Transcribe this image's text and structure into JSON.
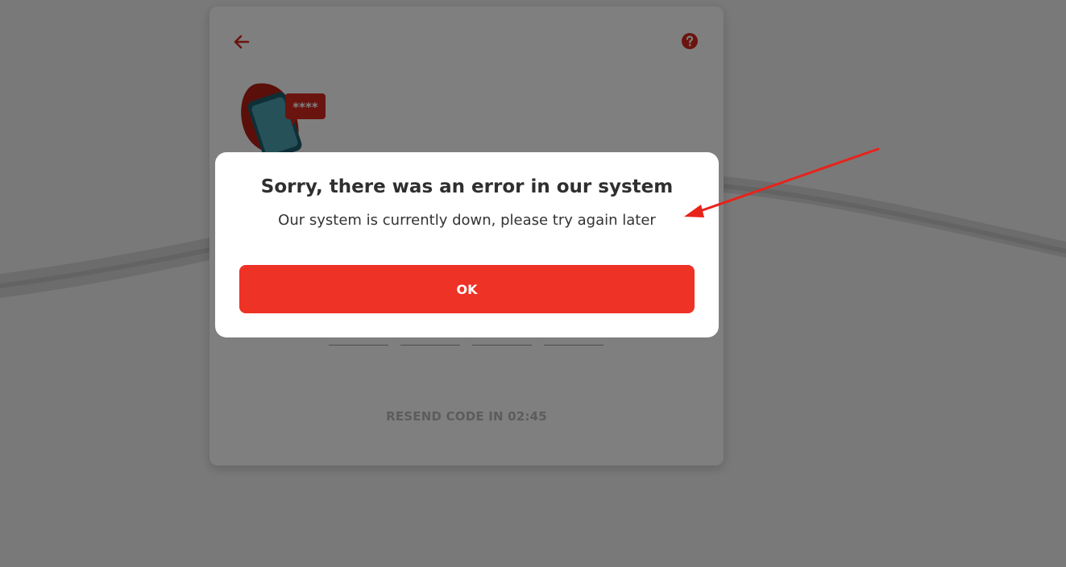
{
  "background": {
    "base_color": "#f3f3f3",
    "wave_color": "#d8d8d8"
  },
  "card": {
    "back_icon": "arrow-left-icon",
    "help_icon": "question-circle-icon",
    "illustration": "phone-sms-code-illustration",
    "code_mask": "****",
    "code_box_count": 4,
    "resend_text": "RESEND CODE IN 02:45",
    "accent_color": "#d4291f"
  },
  "overlay": {
    "color": "rgba(0,0,0,0.5)"
  },
  "modal": {
    "title": "Sorry, there was an error in our system",
    "message": "Our system is currently down, please try again later",
    "ok_label": "OK",
    "button_color": "#ef3226"
  },
  "annotation": {
    "arrow_color": "#e8231a"
  }
}
